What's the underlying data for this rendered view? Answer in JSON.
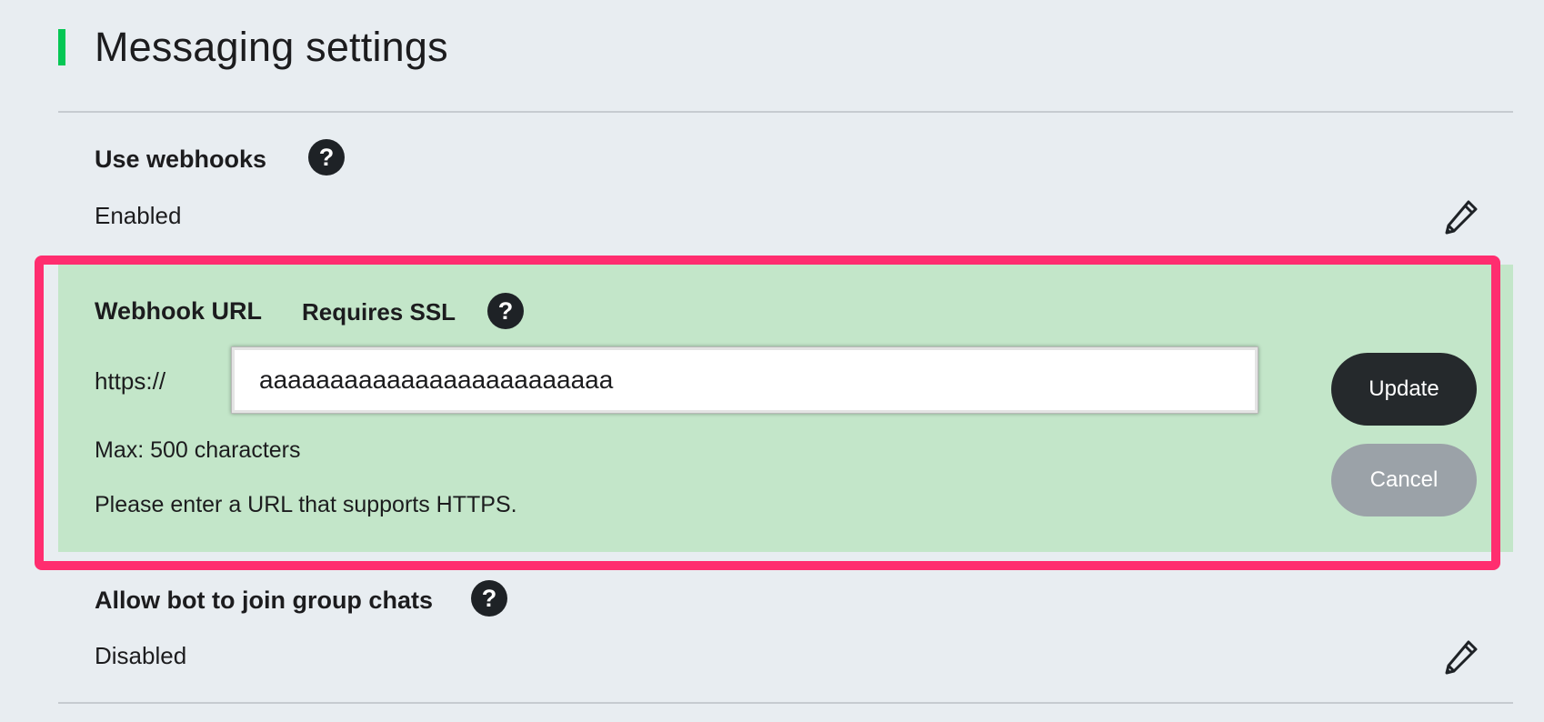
{
  "header": {
    "title": "Messaging settings",
    "accent_color": "#06c755"
  },
  "webhooks": {
    "label": "Use webhooks",
    "value": "Enabled",
    "help_icon": "?"
  },
  "webhook_url": {
    "label": "Webhook URL",
    "ssl_note": "Requires SSL",
    "help_icon": "?",
    "scheme_prefix": "https://",
    "input_value": "aaaaaaaaaaaaaaaaaaaaaaaaa",
    "max_note": "Max: 500 characters",
    "hint": "Please enter a URL that supports HTTPS.",
    "update_label": "Update",
    "cancel_label": "Cancel"
  },
  "group_chats": {
    "label": "Allow bot to join group chats",
    "value": "Disabled",
    "help_icon": "?"
  },
  "colors": {
    "highlight": "#ff2d6f",
    "panel_background": "#c3e6c9",
    "page_background": "#e8edf1"
  }
}
